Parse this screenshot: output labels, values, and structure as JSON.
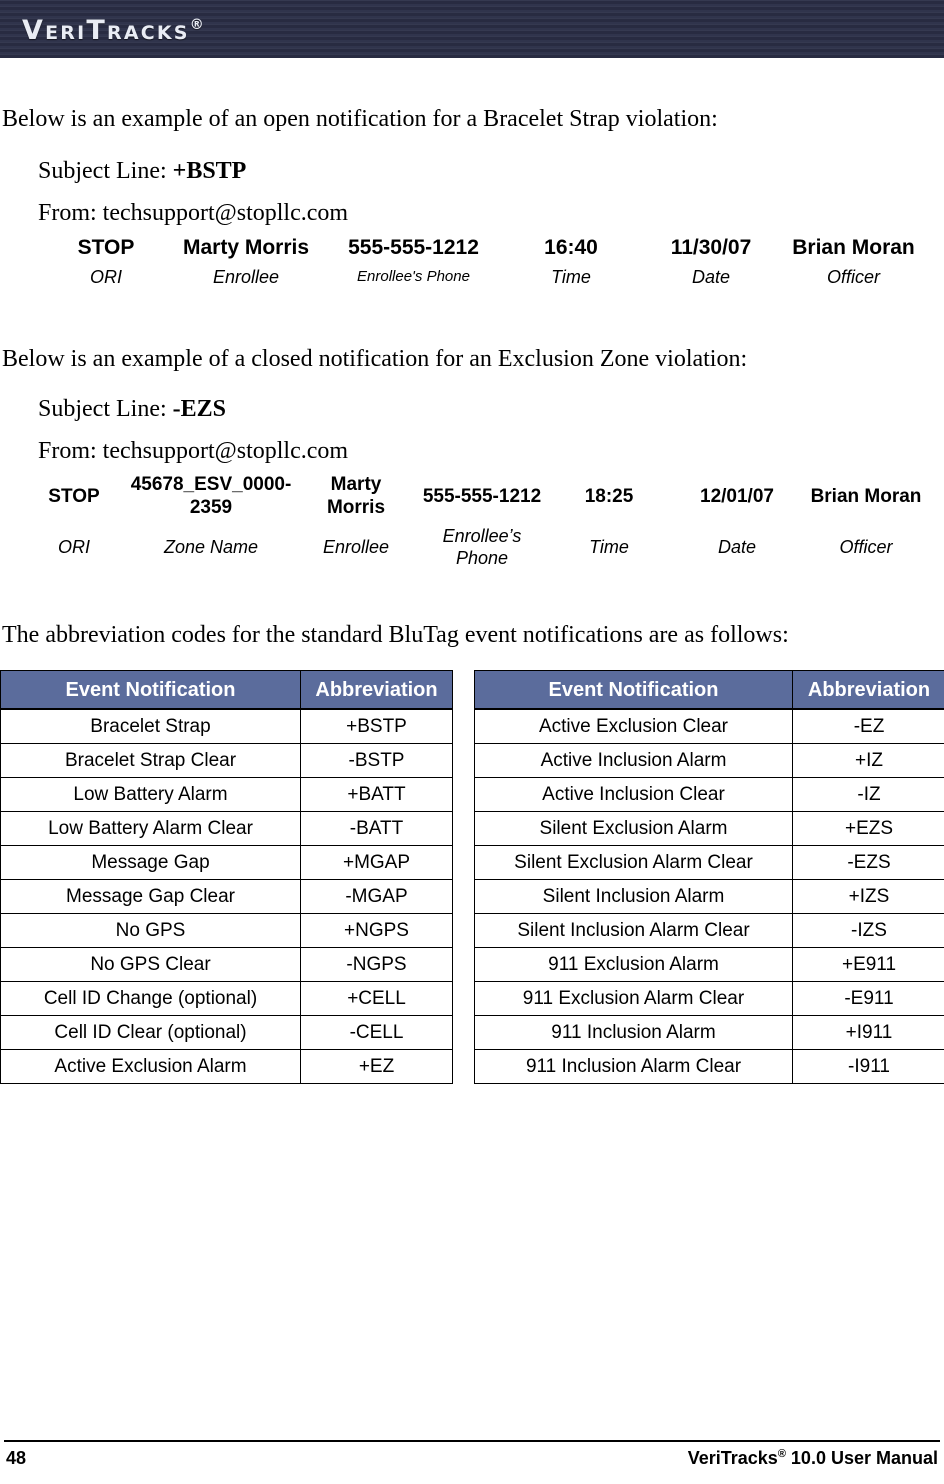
{
  "header": {
    "logo_text": "VeriTracks",
    "logo_registered_mark": "®"
  },
  "body": {
    "intro_open": "Below is an example of an open notification for a Bracelet Strap violation:",
    "intro_closed": "Below is an example of a closed notification for an Exclusion Zone violation:",
    "intro_codes": "The abbreviation codes for the standard BluTag event notifications are as follows:"
  },
  "example_open": {
    "subject_prefix": "Subject Line: ",
    "subject_value": "+BSTP",
    "from_line": "From: techsupport@stopllc.com",
    "values": [
      "STOP",
      "Marty Morris",
      "555-555-1212",
      "16:40",
      "11/30/07",
      "Brian Moran"
    ],
    "labels": [
      "ORI",
      "Enrollee",
      "Enrollee's Phone",
      "Time",
      "Date",
      "Officer"
    ]
  },
  "example_closed": {
    "subject_prefix": "Subject Line: ",
    "subject_value": "-EZS",
    "from_line": "From: techsupport@stopllc.com",
    "values": [
      "STOP",
      "45678_ESV_0000-2359",
      "Marty Morris",
      "555-555-1212",
      "18:25",
      "12/01/07",
      "Brian Moran"
    ],
    "labels": [
      "ORI",
      "Zone Name",
      "Enrollee",
      "Enrollee’s Phone",
      "Time",
      "Date",
      "Officer"
    ]
  },
  "abbreviation_tables": {
    "header_color": "#5b6c9c",
    "columns": [
      "Event Notification",
      "Abbreviation"
    ],
    "left_rows": [
      [
        "Bracelet Strap",
        "+BSTP"
      ],
      [
        "Bracelet Strap Clear",
        "-BSTP"
      ],
      [
        "Low Battery Alarm",
        "+BATT"
      ],
      [
        "Low Battery Alarm Clear",
        "-BATT"
      ],
      [
        "Message Gap",
        "+MGAP"
      ],
      [
        "Message Gap Clear",
        "-MGAP"
      ],
      [
        "No GPS",
        "+NGPS"
      ],
      [
        "No GPS Clear",
        "-NGPS"
      ],
      [
        "Cell ID Change (optional)",
        "+CELL"
      ],
      [
        "Cell ID Clear (optional)",
        "-CELL"
      ],
      [
        "Active Exclusion Alarm",
        "+EZ"
      ]
    ],
    "right_rows": [
      [
        "Active Exclusion Clear",
        "-EZ"
      ],
      [
        "Active Inclusion Alarm",
        "+IZ"
      ],
      [
        "Active Inclusion Clear",
        "-IZ"
      ],
      [
        "Silent Exclusion Alarm",
        "+EZS"
      ],
      [
        "Silent Exclusion Alarm Clear",
        "-EZS"
      ],
      [
        "Silent Inclusion Alarm",
        "+IZS"
      ],
      [
        "Silent Inclusion Alarm Clear",
        "-IZS"
      ],
      [
        "911 Exclusion Alarm",
        "+E911"
      ],
      [
        "911 Exclusion Alarm Clear",
        "-E911"
      ],
      [
        "911 Inclusion Alarm",
        "+I911"
      ],
      [
        "911 Inclusion Alarm Clear",
        "-I911"
      ]
    ]
  },
  "footer": {
    "page_number": "48",
    "manual_prefix": "VeriTracks",
    "manual_registered_mark": "®",
    "manual_suffix": " 10.0 User Manual"
  }
}
